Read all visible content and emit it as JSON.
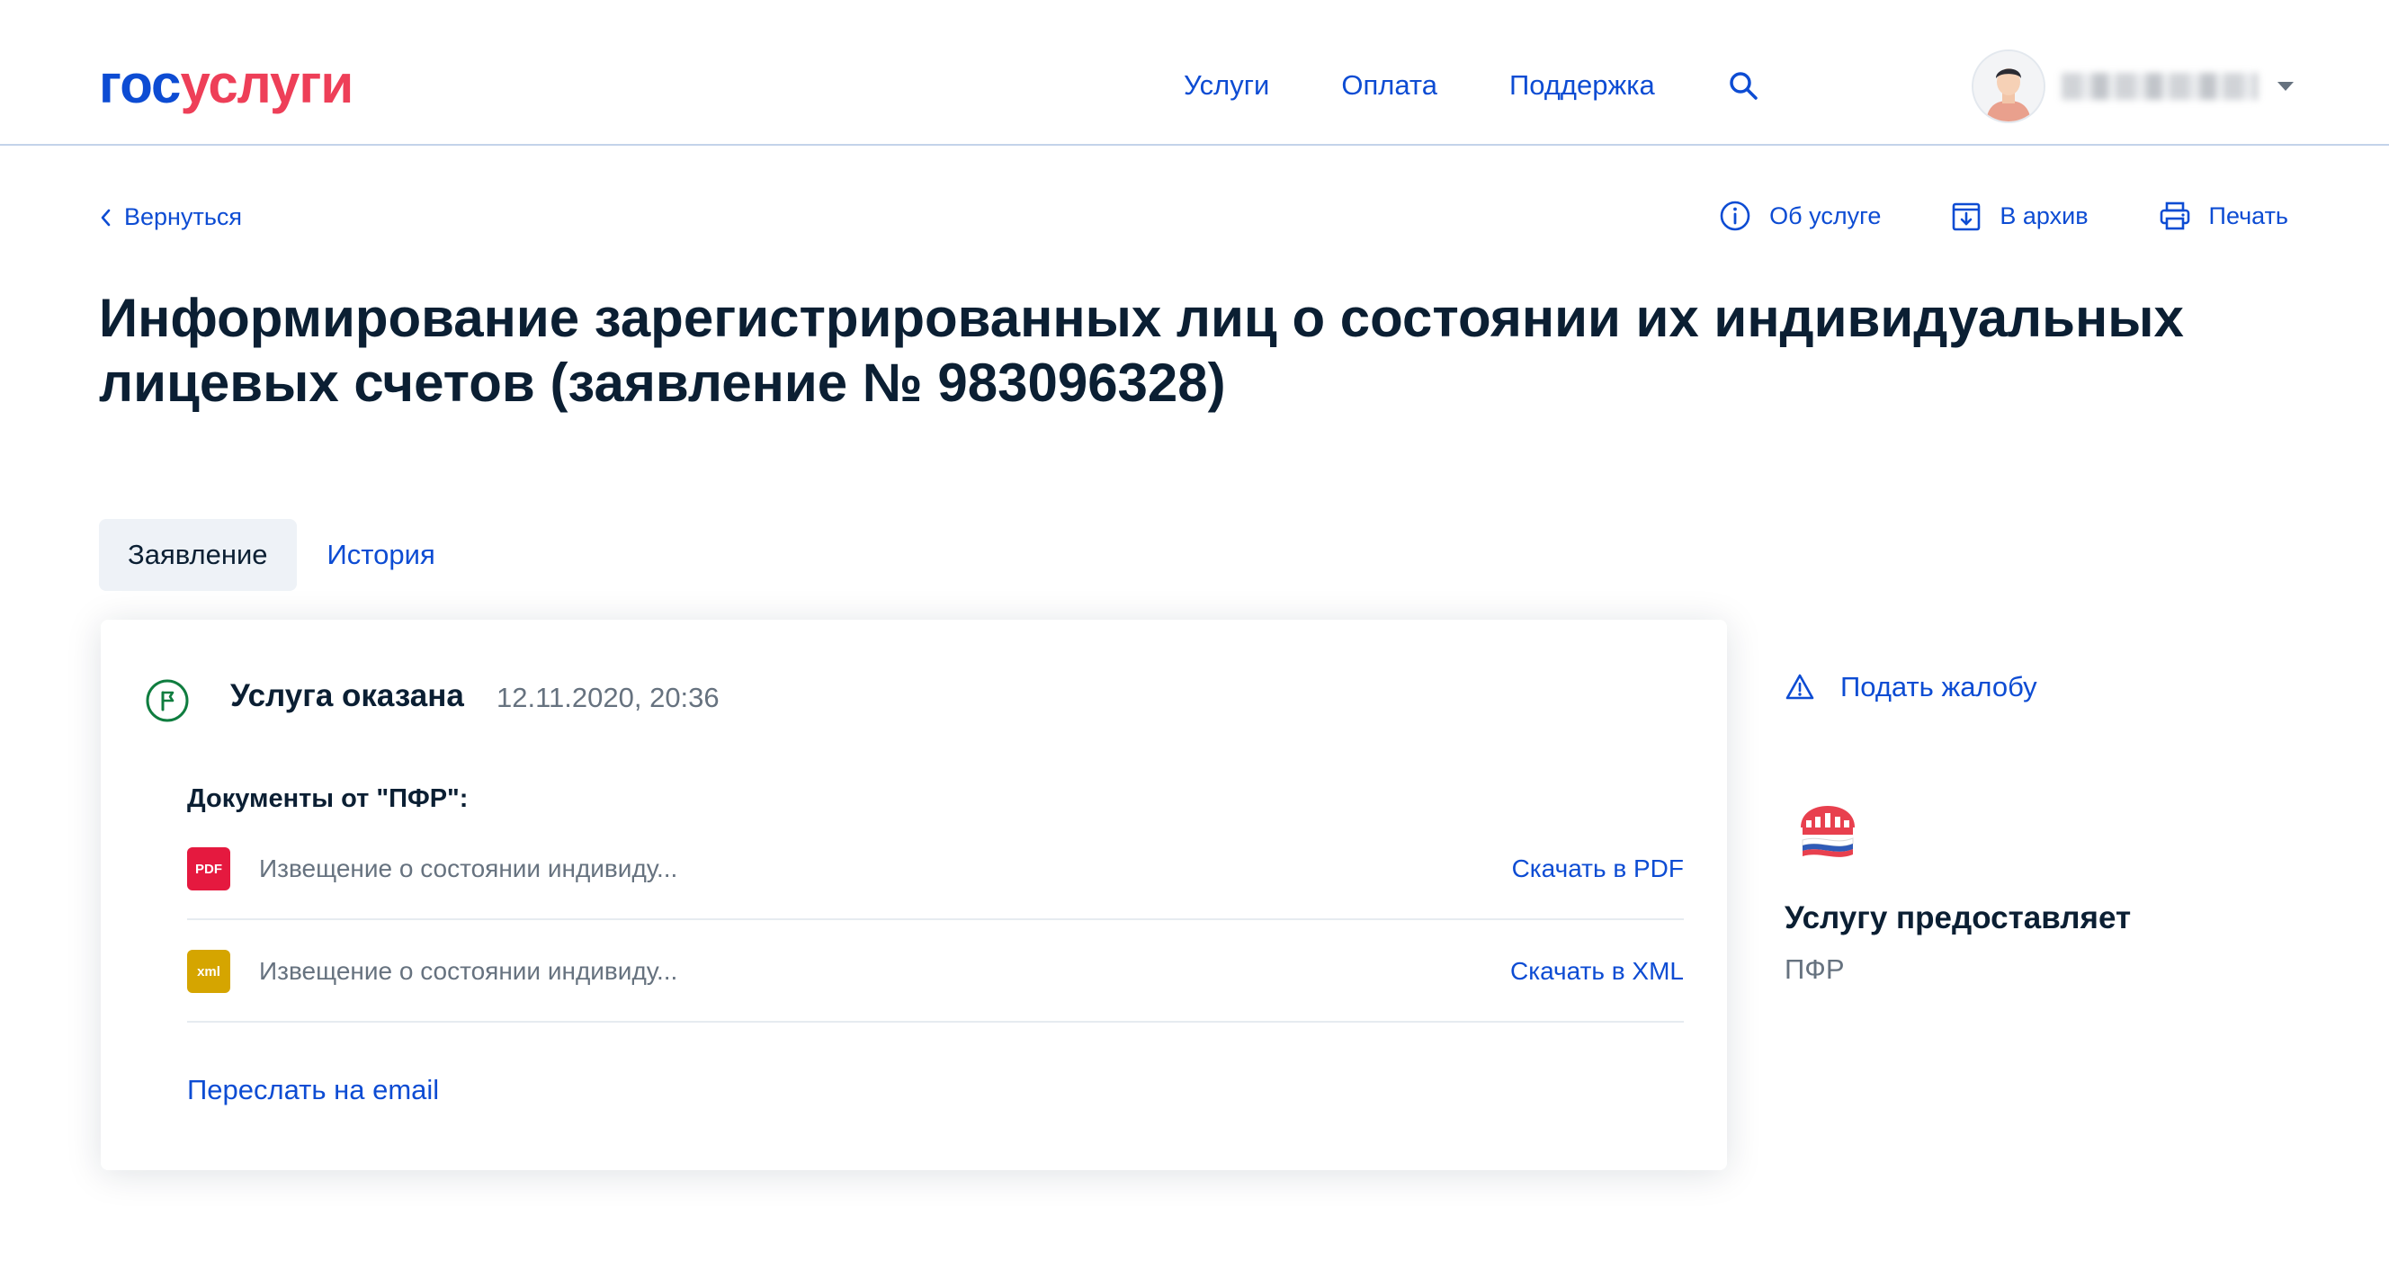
{
  "header": {
    "logo": {
      "part1": "гос",
      "part2": "услуги"
    },
    "nav": [
      "Услуги",
      "Оплата",
      "Поддержка"
    ],
    "search_icon": "search-icon",
    "avatar_icon": "user-avatar"
  },
  "toolbar": {
    "back_label": "Вернуться",
    "about_label": "Об услуге",
    "archive_label": "В архив",
    "print_label": "Печать"
  },
  "page": {
    "title": "Информирование зарегистрированных лиц о состоянии их индивидуальных лицевых счетов (заявление № 983096328)"
  },
  "tabs": [
    {
      "label": "Заявление",
      "active": true
    },
    {
      "label": "История",
      "active": false
    }
  ],
  "status": {
    "title": "Услуга оказана",
    "date": "12.11.2020, 20:36",
    "icon": "flag-icon"
  },
  "documents": {
    "title": "Документы от \"ПФР\":",
    "items": [
      {
        "badge": "PDF",
        "badge_color": "#e5193f",
        "name": "Извещение о состоянии индивиду...",
        "link": "Скачать в PDF"
      },
      {
        "badge": "xml",
        "badge_color": "#d5a500",
        "name": "Извещение о состоянии индивиду...",
        "link": "Скачать в XML"
      }
    ],
    "email_link": "Переслать на email"
  },
  "sidebar": {
    "complaint": "Подать жалобу",
    "provider_label": "Услугу предоставляет",
    "provider_name": "ПФР"
  },
  "colors": {
    "link": "#0d4cd3",
    "text": "#0b1f33",
    "muted": "#66727f",
    "success": "#0f7d3f",
    "logo_red": "#ee3f58"
  }
}
